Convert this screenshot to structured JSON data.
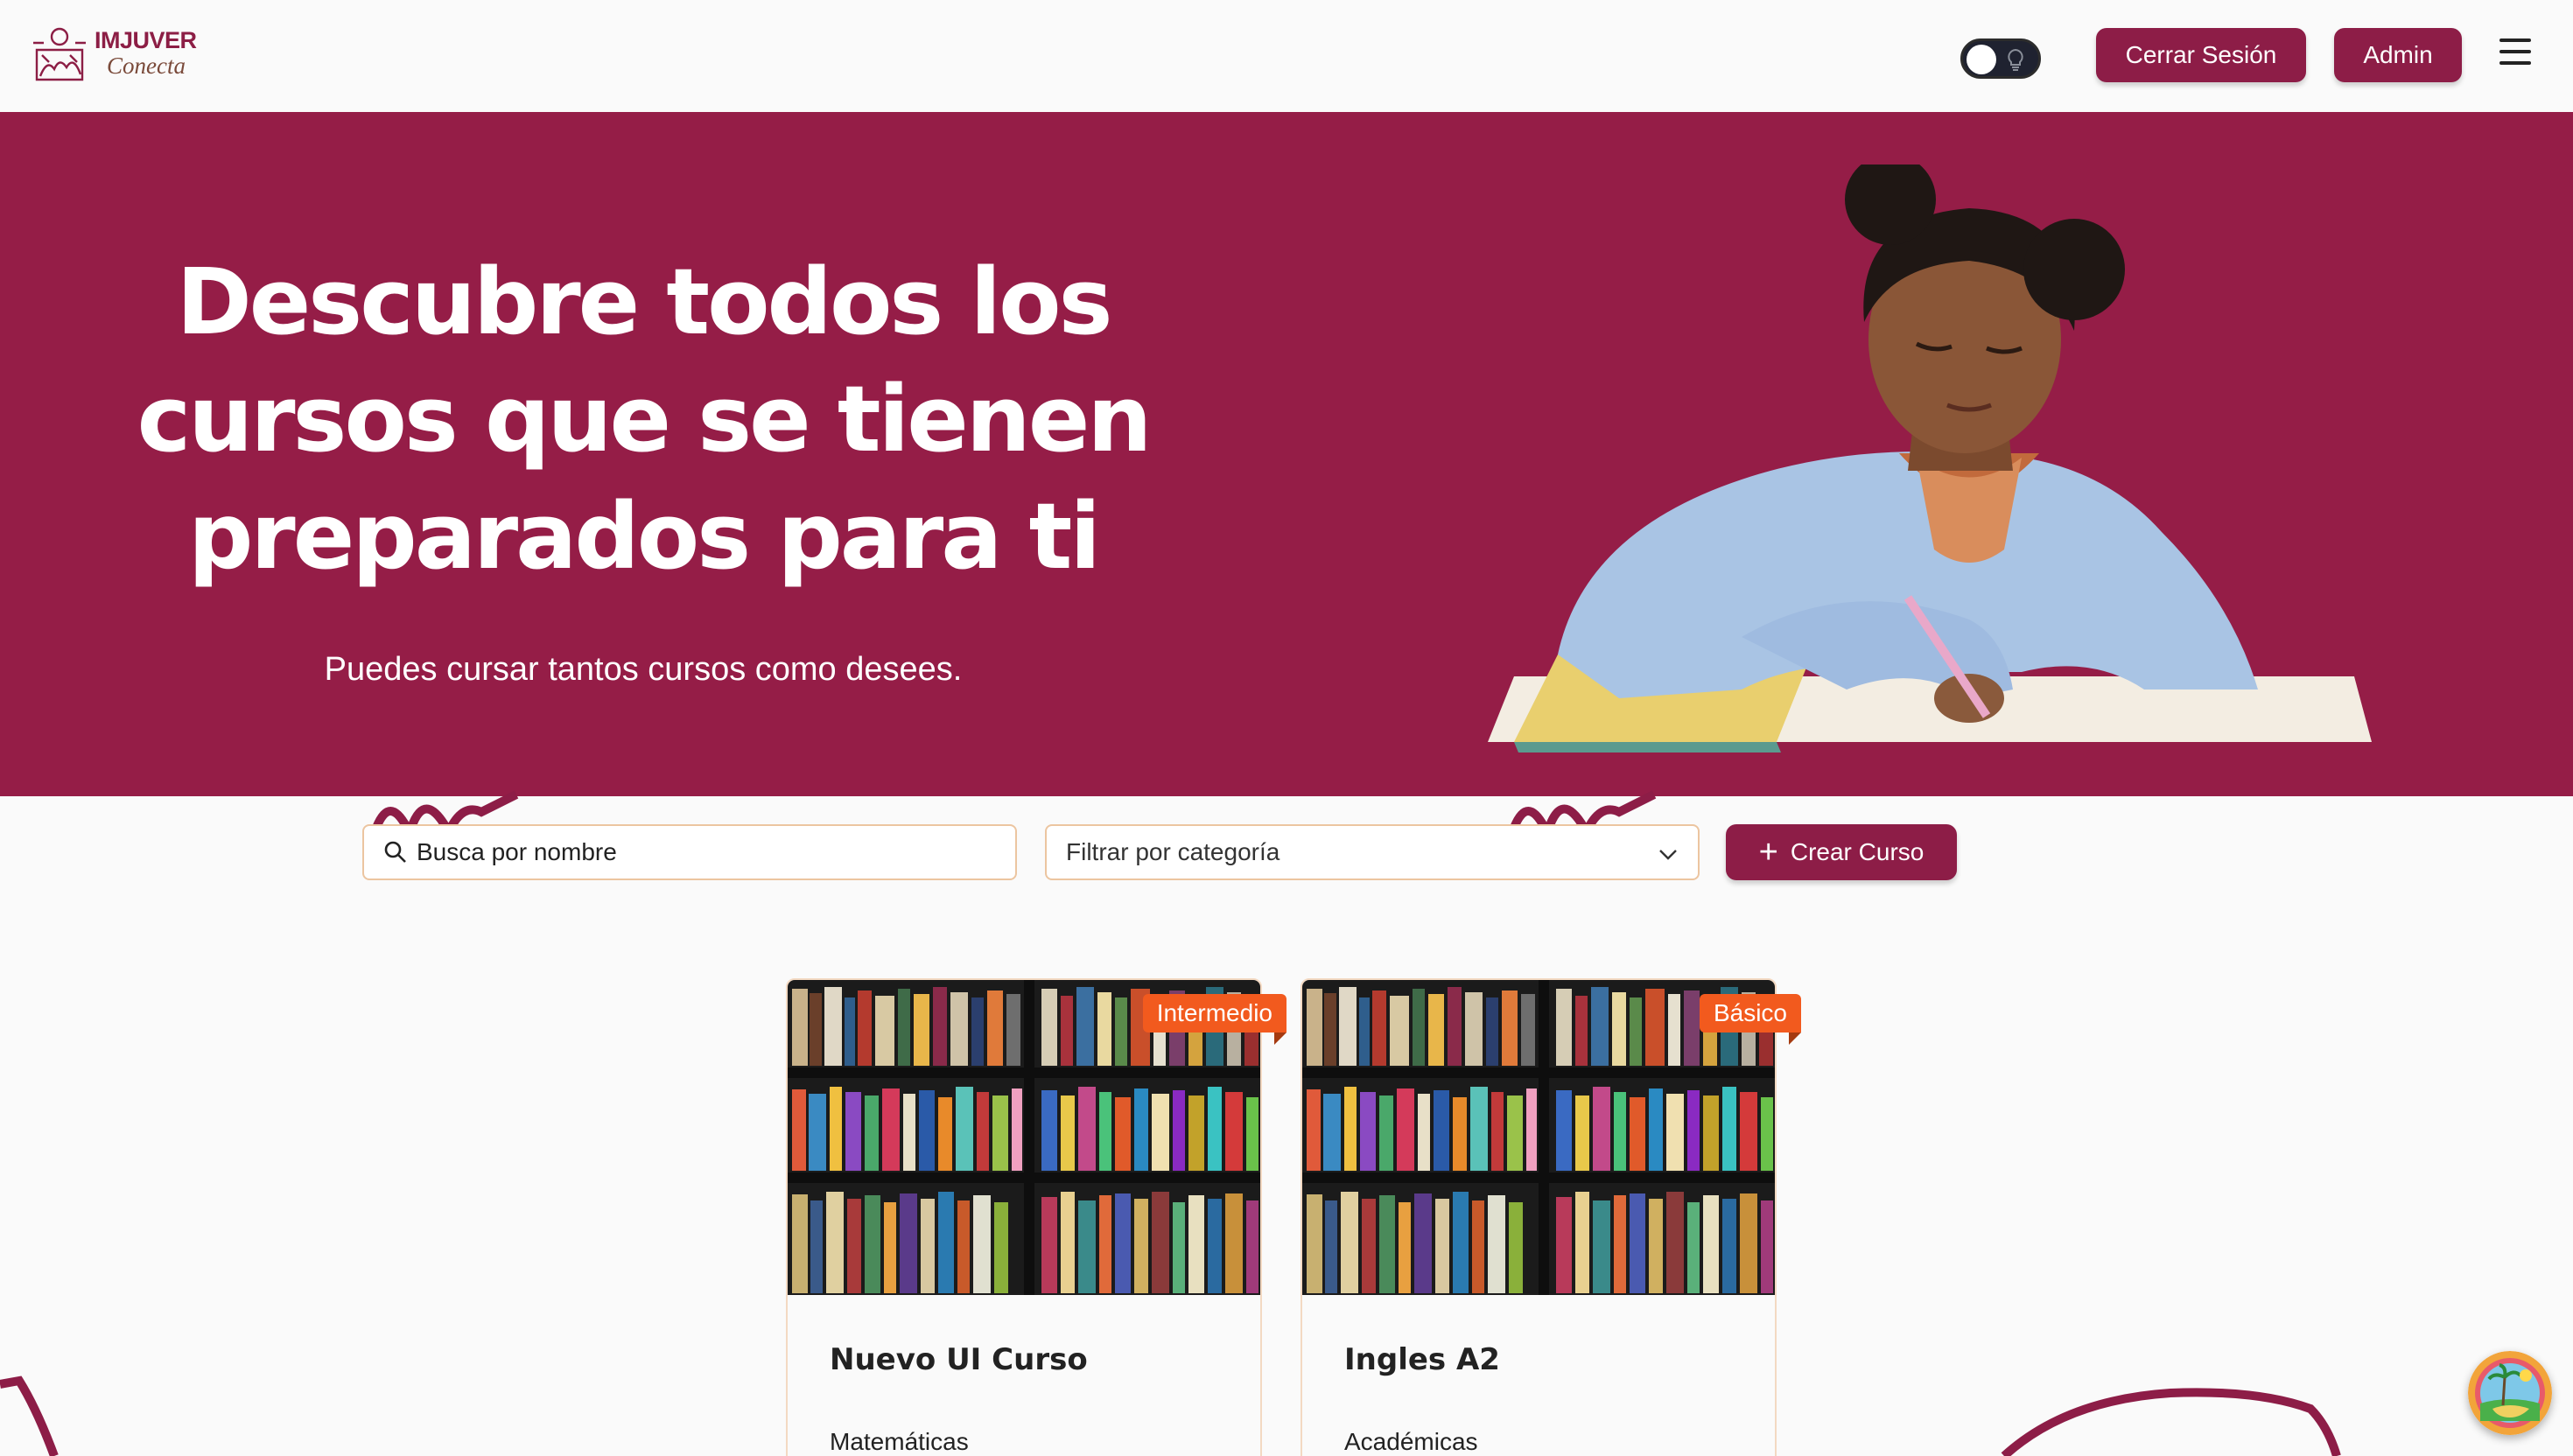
{
  "brand": {
    "name": "IMJUVER",
    "tagline": "Conecta",
    "color": "#951d47"
  },
  "navbar": {
    "theme_toggle": "dark-mode-toggle",
    "logout_label": "Cerrar Sesión",
    "admin_label": "Admin",
    "menu_icon": "hamburger-menu-icon"
  },
  "hero": {
    "title": "Descubre todos los cursos que se tienen preparados para ti",
    "subtitle": "Puedes cursar tantos cursos como desees."
  },
  "filters": {
    "search_placeholder": "Busca por nombre",
    "category_placeholder": "Filtrar por categoría",
    "create_label": "Crear Curso"
  },
  "courses": [
    {
      "title": "Nuevo UI Curso",
      "category": "Matemáticas",
      "level": "Intermedio"
    },
    {
      "title": "Ingles A2",
      "category": "Académicas",
      "level": "Básico"
    }
  ],
  "colors": {
    "primary": "#8d1d47",
    "badge": "#f25a1e",
    "input_border": "#ecc5a0"
  }
}
